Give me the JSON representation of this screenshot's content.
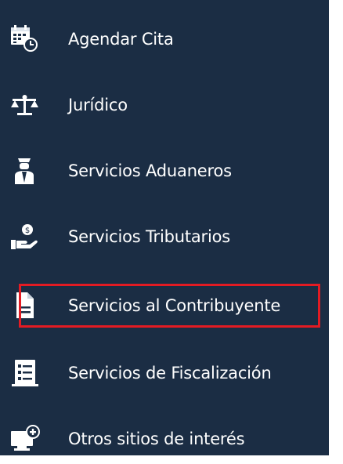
{
  "menu": {
    "items": [
      {
        "label": "Agendar Cita",
        "icon": "calendar-clock-icon"
      },
      {
        "label": "Jurídico",
        "icon": "scales-icon"
      },
      {
        "label": "Servicios Aduaneros",
        "icon": "customs-officer-icon"
      },
      {
        "label": "Servicios Tributarios",
        "icon": "hand-coin-icon"
      },
      {
        "label": "Servicios al Contribuyente",
        "icon": "document-icon"
      },
      {
        "label": "Servicios de Fiscalización",
        "icon": "checklist-icon"
      },
      {
        "label": "Otros sitios de interés",
        "icon": "monitor-plus-icon"
      }
    ]
  },
  "colors": {
    "background": "#1b2d44",
    "text": "#ffffff",
    "highlight_border": "#e31b23"
  }
}
